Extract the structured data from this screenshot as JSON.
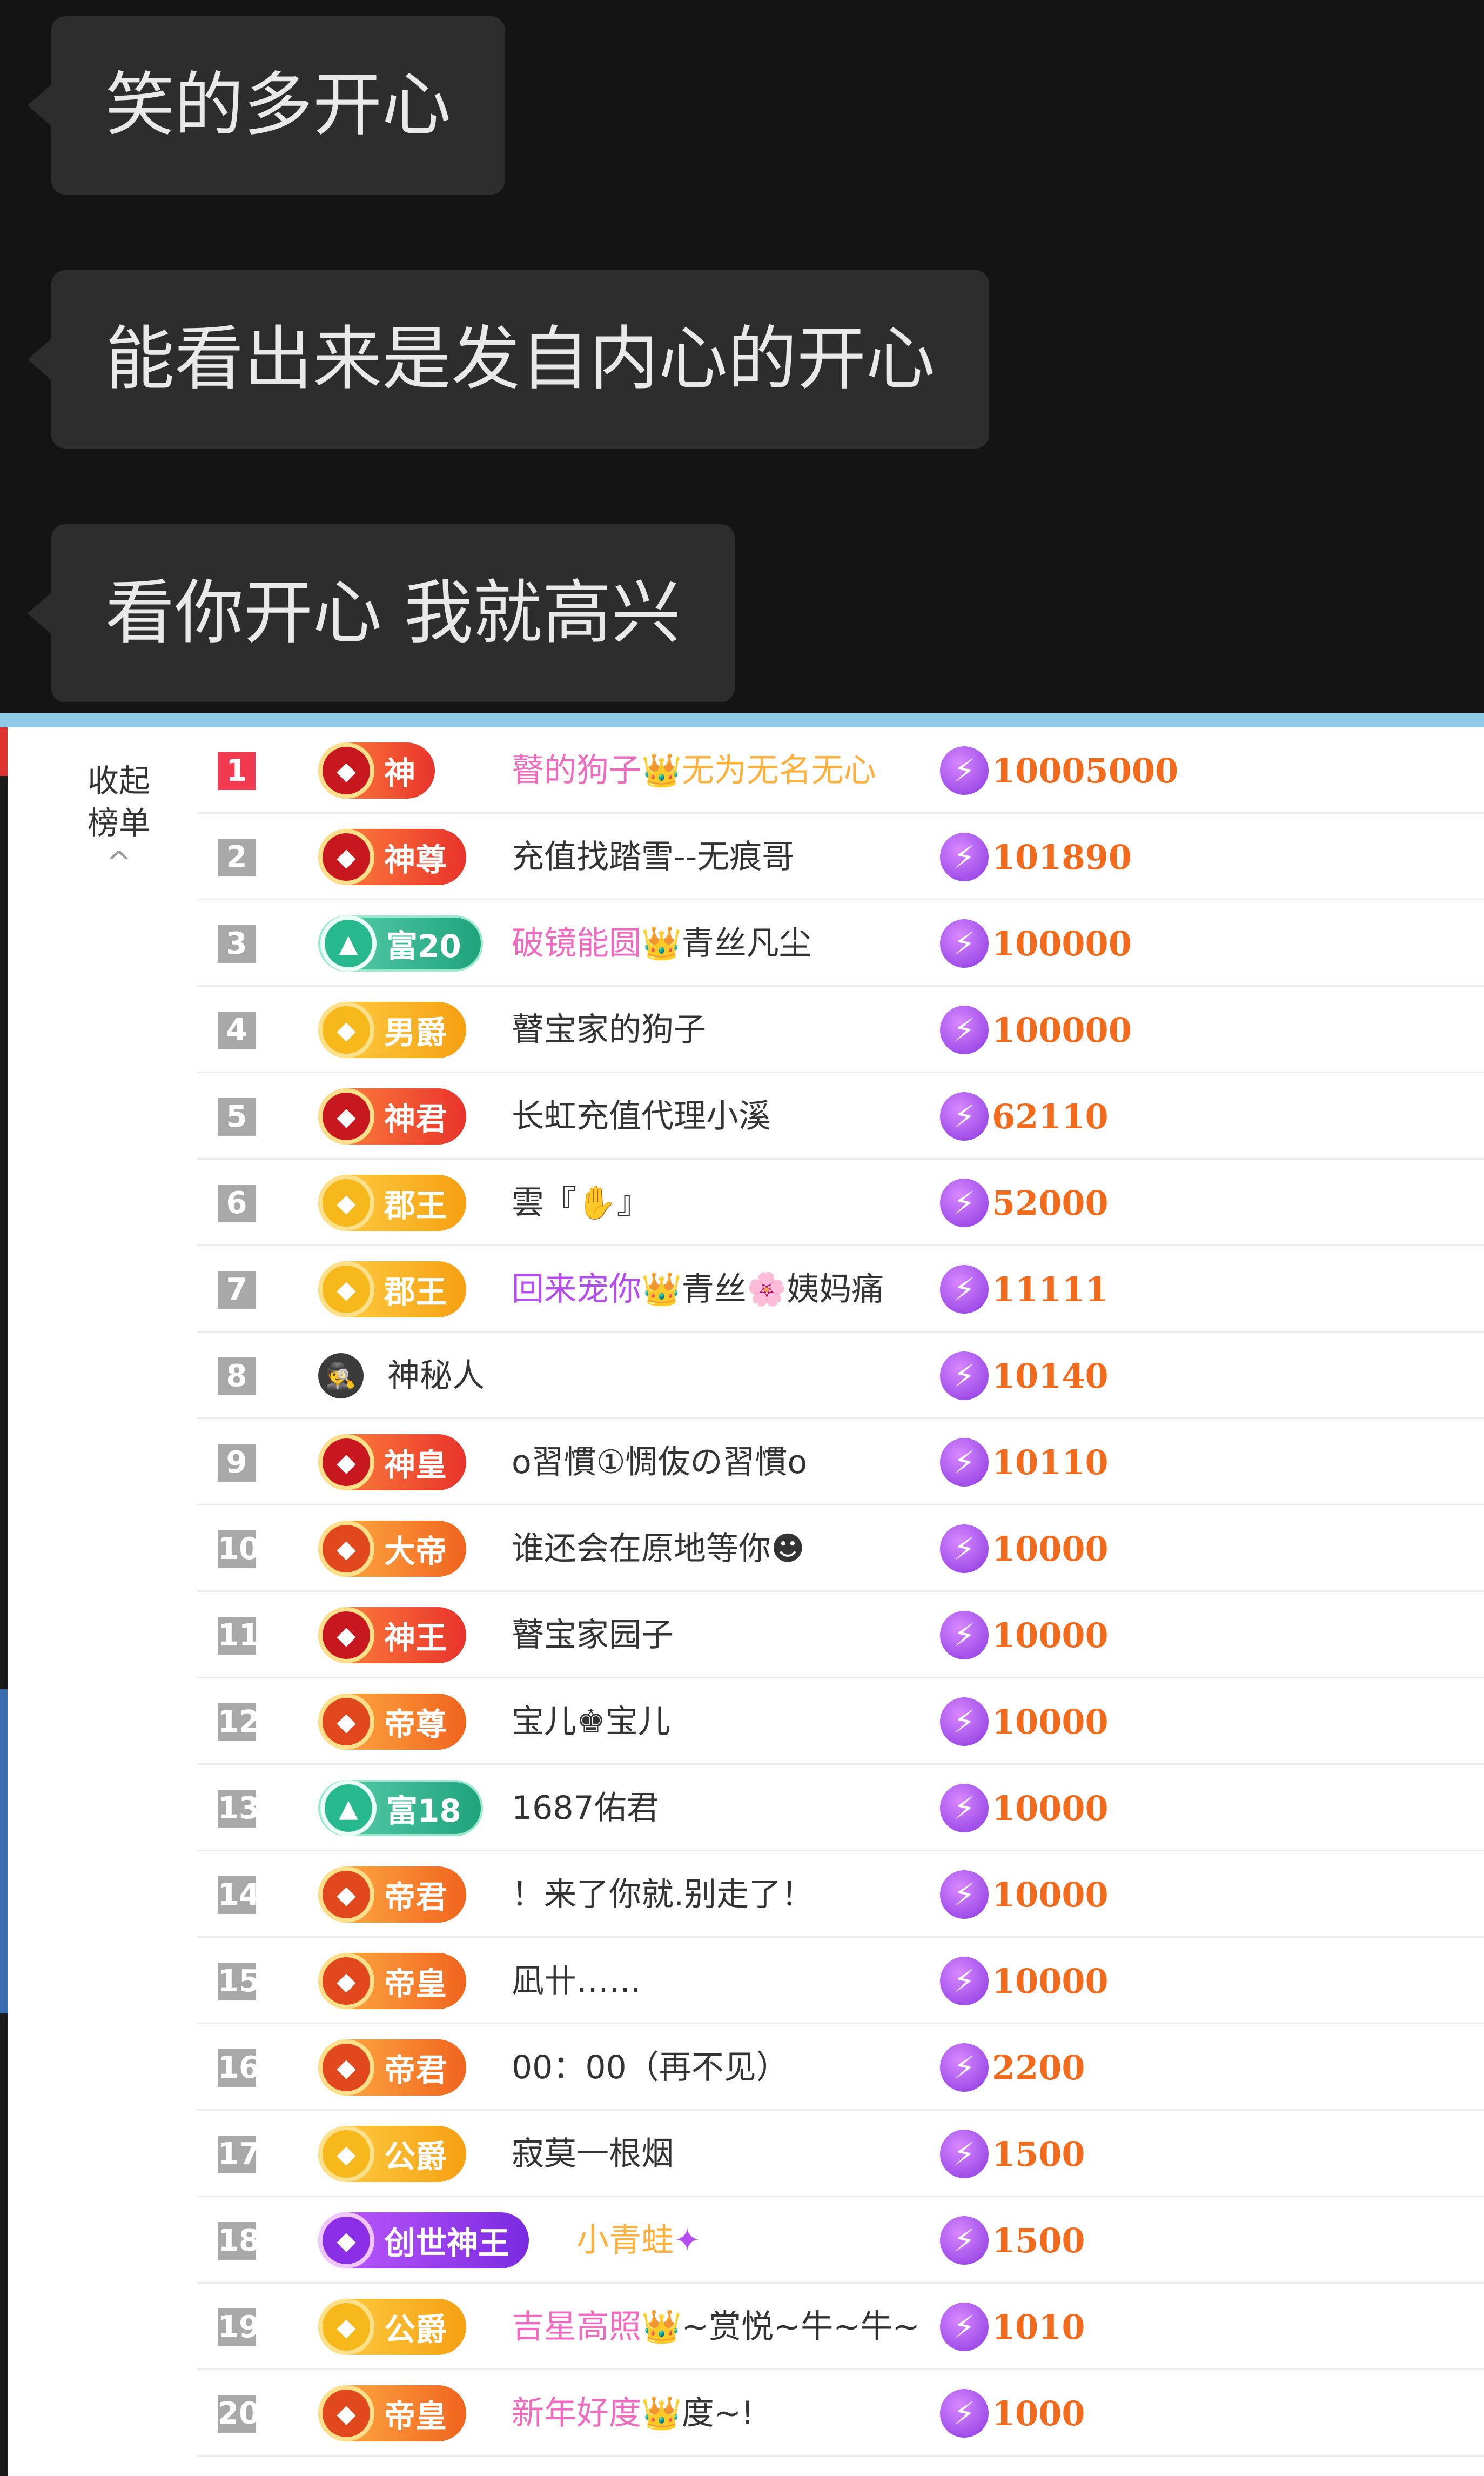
{
  "chat": {
    "messages": [
      "笑的多开心",
      "能看出来是发自内心的开心",
      "看你开心 我就高兴"
    ]
  },
  "board": {
    "collapse_label": "收起\n榜单",
    "collapse_line1": "收起",
    "collapse_line2": "榜单",
    "chevron": "^",
    "rows": [
      {
        "rank": "1",
        "badge": "神",
        "theme": "red",
        "name_parts": [
          {
            "t": "瞽的狗子",
            "c": "pink"
          },
          {
            "t": "👑",
            "c": "pink"
          },
          {
            "t": "无为无名无心",
            "c": "orangeTxt"
          }
        ],
        "score": "10005000"
      },
      {
        "rank": "2",
        "badge": "神尊",
        "theme": "red",
        "name_parts": [
          {
            "t": "充值找踏雪--无痕哥",
            "c": ""
          }
        ],
        "score": "101890"
      },
      {
        "rank": "3",
        "badge": "富20",
        "theme": "green",
        "name_parts": [
          {
            "t": "破镜能圆",
            "c": "pink"
          },
          {
            "t": "👑",
            "c": "pink"
          },
          {
            "t": "青丝凡尘",
            "c": ""
          }
        ],
        "score": "100000"
      },
      {
        "rank": "4",
        "badge": "男爵",
        "theme": "gold",
        "name_parts": [
          {
            "t": "瞽宝家的狗子",
            "c": ""
          }
        ],
        "score": "100000"
      },
      {
        "rank": "5",
        "badge": "神君",
        "theme": "red",
        "name_parts": [
          {
            "t": "长虹充值代理小溪",
            "c": ""
          }
        ],
        "score": "62110"
      },
      {
        "rank": "6",
        "badge": "郡王",
        "theme": "gold",
        "name_parts": [
          {
            "t": "雲『✋』",
            "c": ""
          }
        ],
        "score": "52000"
      },
      {
        "rank": "7",
        "badge": "郡王",
        "theme": "gold",
        "name_parts": [
          {
            "t": "回来宠你",
            "c": "blueTxt"
          },
          {
            "t": "👑",
            "c": "blueTxt"
          },
          {
            "t": "青丝🌸姨妈痛",
            "c": ""
          }
        ],
        "score": "11111"
      },
      {
        "rank": "8",
        "badge": "",
        "theme": "plain",
        "name_parts": [
          {
            "t": "神秘人",
            "c": ""
          }
        ],
        "score": "10140"
      },
      {
        "rank": "9",
        "badge": "神皇",
        "theme": "red",
        "name_parts": [
          {
            "t": "o習慣①惆伖の習慣o",
            "c": ""
          }
        ],
        "score": "10110"
      },
      {
        "rank": "10",
        "badge": "大帝",
        "theme": "orange",
        "name_parts": [
          {
            "t": "谁还会在原地等你☻",
            "c": ""
          }
        ],
        "score": "10000"
      },
      {
        "rank": "11",
        "badge": "神王",
        "theme": "red",
        "name_parts": [
          {
            "t": "瞽宝家园子",
            "c": ""
          }
        ],
        "score": "10000"
      },
      {
        "rank": "12",
        "badge": "帝尊",
        "theme": "orange",
        "name_parts": [
          {
            "t": "宝儿♚宝儿",
            "c": ""
          }
        ],
        "score": "10000"
      },
      {
        "rank": "13",
        "badge": "富18",
        "theme": "green",
        "name_parts": [
          {
            "t": "1687佑君",
            "c": ""
          }
        ],
        "score": "10000"
      },
      {
        "rank": "14",
        "badge": "帝君",
        "theme": "orange",
        "name_parts": [
          {
            "t": "！来了你就.别走了！",
            "c": ""
          }
        ],
        "score": "10000"
      },
      {
        "rank": "15",
        "badge": "帝皇",
        "theme": "orange",
        "name_parts": [
          {
            "t": "凪卄……",
            "c": ""
          }
        ],
        "score": "10000"
      },
      {
        "rank": "16",
        "badge": "帝君",
        "theme": "orange",
        "name_parts": [
          {
            "t": "00：00（再不见）",
            "c": ""
          }
        ],
        "score": "2200"
      },
      {
        "rank": "17",
        "badge": "公爵",
        "theme": "gold",
        "name_parts": [
          {
            "t": "寂莫一根烟",
            "c": ""
          }
        ],
        "score": "1500"
      },
      {
        "rank": "18",
        "badge": "创世神王",
        "theme": "purple",
        "name_parts": [
          {
            "t": "小青蛙",
            "c": "orangeTxt"
          },
          {
            "t": "✦",
            "c": "blueTxt"
          }
        ],
        "score": "1500"
      },
      {
        "rank": "19",
        "badge": "公爵",
        "theme": "gold",
        "name_parts": [
          {
            "t": "吉星高照",
            "c": "pink"
          },
          {
            "t": "👑",
            "c": "pink"
          },
          {
            "t": "~赏悦~牛~牛~",
            "c": ""
          }
        ],
        "score": "1010"
      },
      {
        "rank": "20",
        "badge": "帝皇",
        "theme": "orange",
        "name_parts": [
          {
            "t": "新年好度",
            "c": "pink"
          },
          {
            "t": "👑",
            "c": "pink"
          },
          {
            "t": "度~!",
            "c": ""
          }
        ],
        "score": "1000"
      }
    ]
  }
}
